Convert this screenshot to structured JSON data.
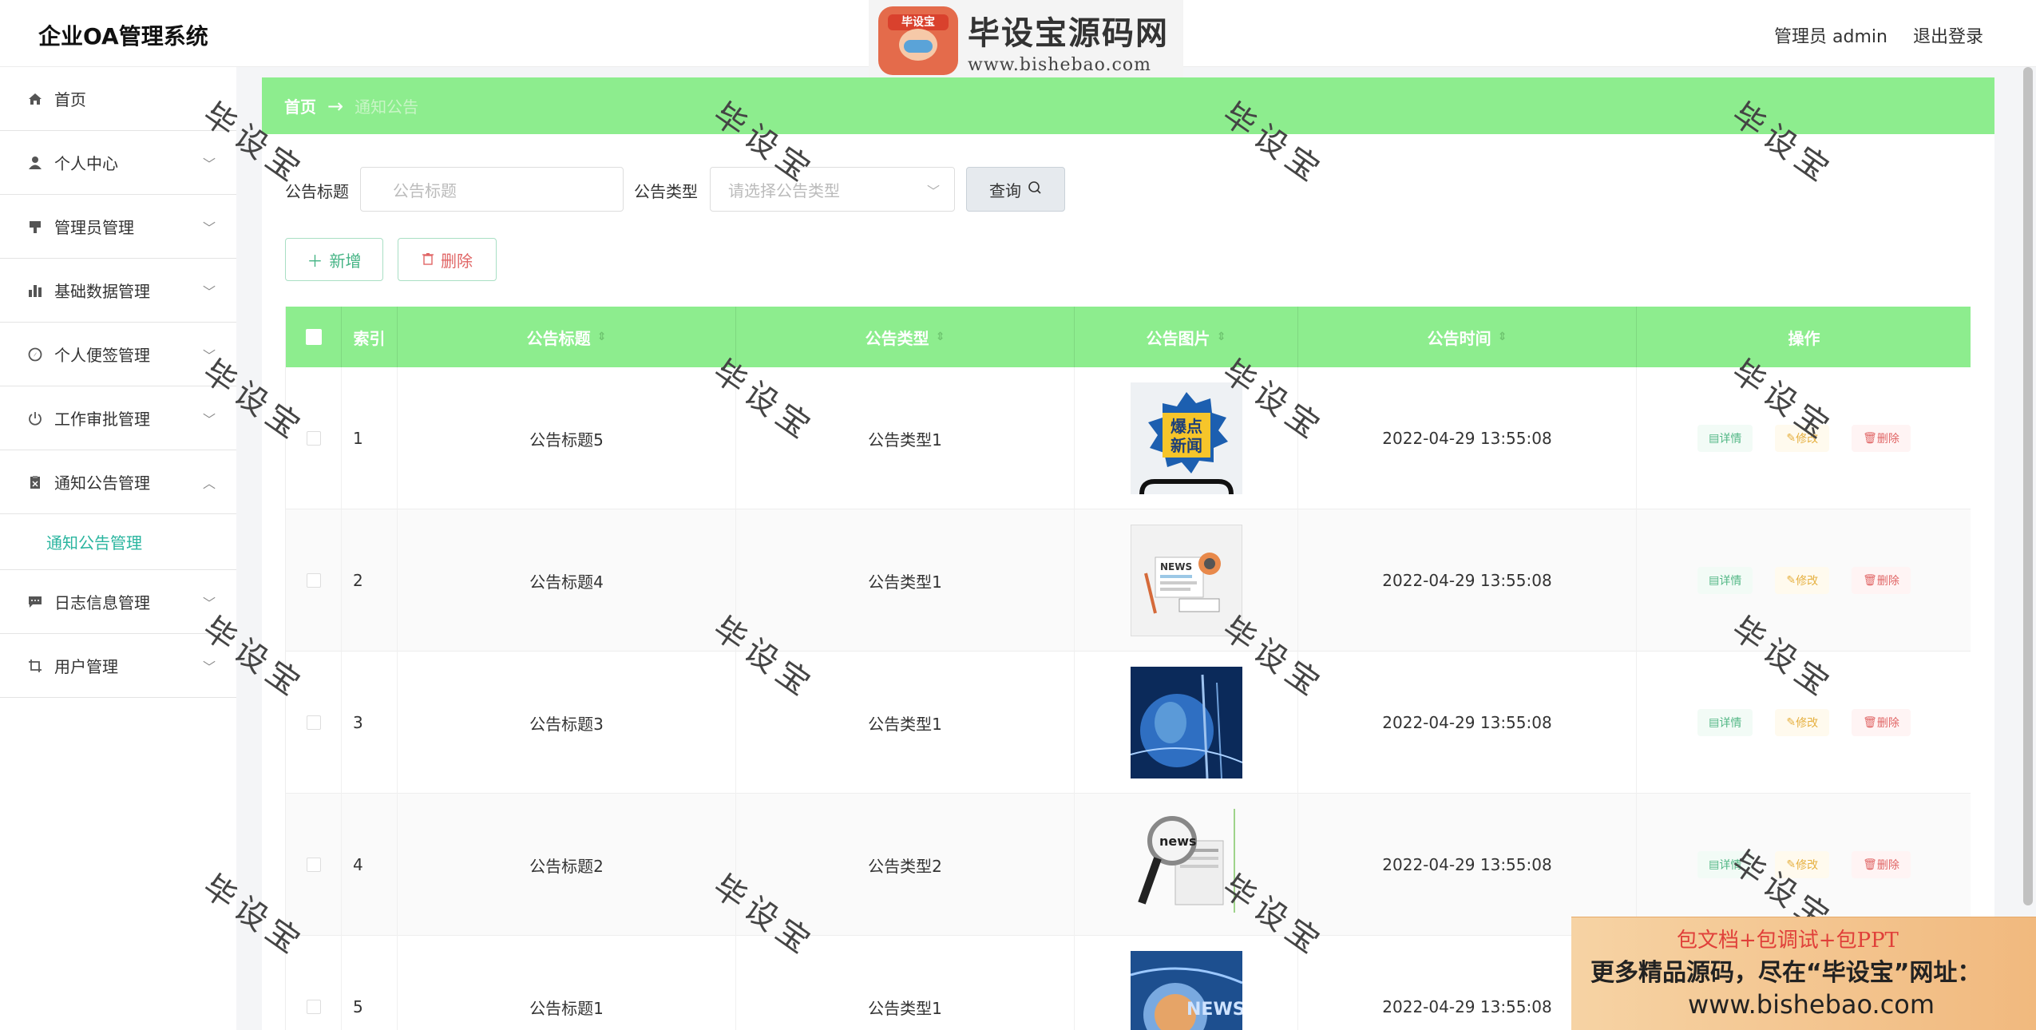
{
  "header": {
    "app_title": "企业OA管理系统",
    "user_label": "管理员 admin",
    "logout_label": "退出登录",
    "logo_tag": "毕设宝",
    "logo_name": "毕设宝源码网",
    "logo_url": "www.bishebao.com"
  },
  "sidebar": {
    "items": [
      {
        "label": "首页",
        "icon": "home-icon"
      },
      {
        "label": "个人中心",
        "icon": "user-icon"
      },
      {
        "label": "管理员管理",
        "icon": "admin-icon"
      },
      {
        "label": "基础数据管理",
        "icon": "bar-chart-icon"
      },
      {
        "label": "个人便签管理",
        "icon": "compass-icon"
      },
      {
        "label": "工作审批管理",
        "icon": "power-icon"
      },
      {
        "label": "通知公告管理",
        "icon": "clipboard-icon"
      },
      {
        "label": "日志信息管理",
        "icon": "chat-icon"
      },
      {
        "label": "用户管理",
        "icon": "crop-icon"
      }
    ],
    "submenu_active": "通知公告管理"
  },
  "breadcrumb": {
    "home": "首页",
    "current": "通知公告"
  },
  "search": {
    "title_label": "公告标题",
    "title_placeholder": "公告标题",
    "type_label": "公告类型",
    "type_placeholder": "请选择公告类型",
    "query_label": "查询"
  },
  "actions": {
    "add_label": "新增",
    "delete_label": "删除"
  },
  "table": {
    "columns": [
      "索引",
      "公告标题",
      "公告类型",
      "公告图片",
      "公告时间",
      "操作"
    ],
    "rows": [
      {
        "index": "1",
        "title": "公告标题5",
        "type": "公告类型1",
        "time": "2022-04-29 13:55:08",
        "image": "breaking-news"
      },
      {
        "index": "2",
        "title": "公告标题4",
        "type": "公告类型1",
        "time": "2022-04-29 13:55:08",
        "image": "news-illustration"
      },
      {
        "index": "3",
        "title": "公告标题3",
        "type": "公告类型1",
        "time": "2022-04-29 13:55:08",
        "image": "globe"
      },
      {
        "index": "4",
        "title": "公告标题2",
        "type": "公告类型2",
        "time": "2022-04-29 13:55:08",
        "image": "magnifier-news"
      },
      {
        "index": "5",
        "title": "公告标题1",
        "type": "公告类型1",
        "time": "2022-04-29 13:55:08",
        "image": "news-globe"
      }
    ],
    "op_detail": "详情",
    "op_edit": "修改",
    "op_delete": "删除"
  },
  "watermark": "毕设宝",
  "ad": {
    "line1": "包文档+包调试+包PPT",
    "line2": "更多精品源码，尽在“毕设宝”网址：",
    "line3": "www.bishebao.com"
  },
  "colors": {
    "accent_green": "#8ded8e",
    "active_submenu": "#2ab59f",
    "danger": "#e06565",
    "warning": "#e6b040"
  }
}
